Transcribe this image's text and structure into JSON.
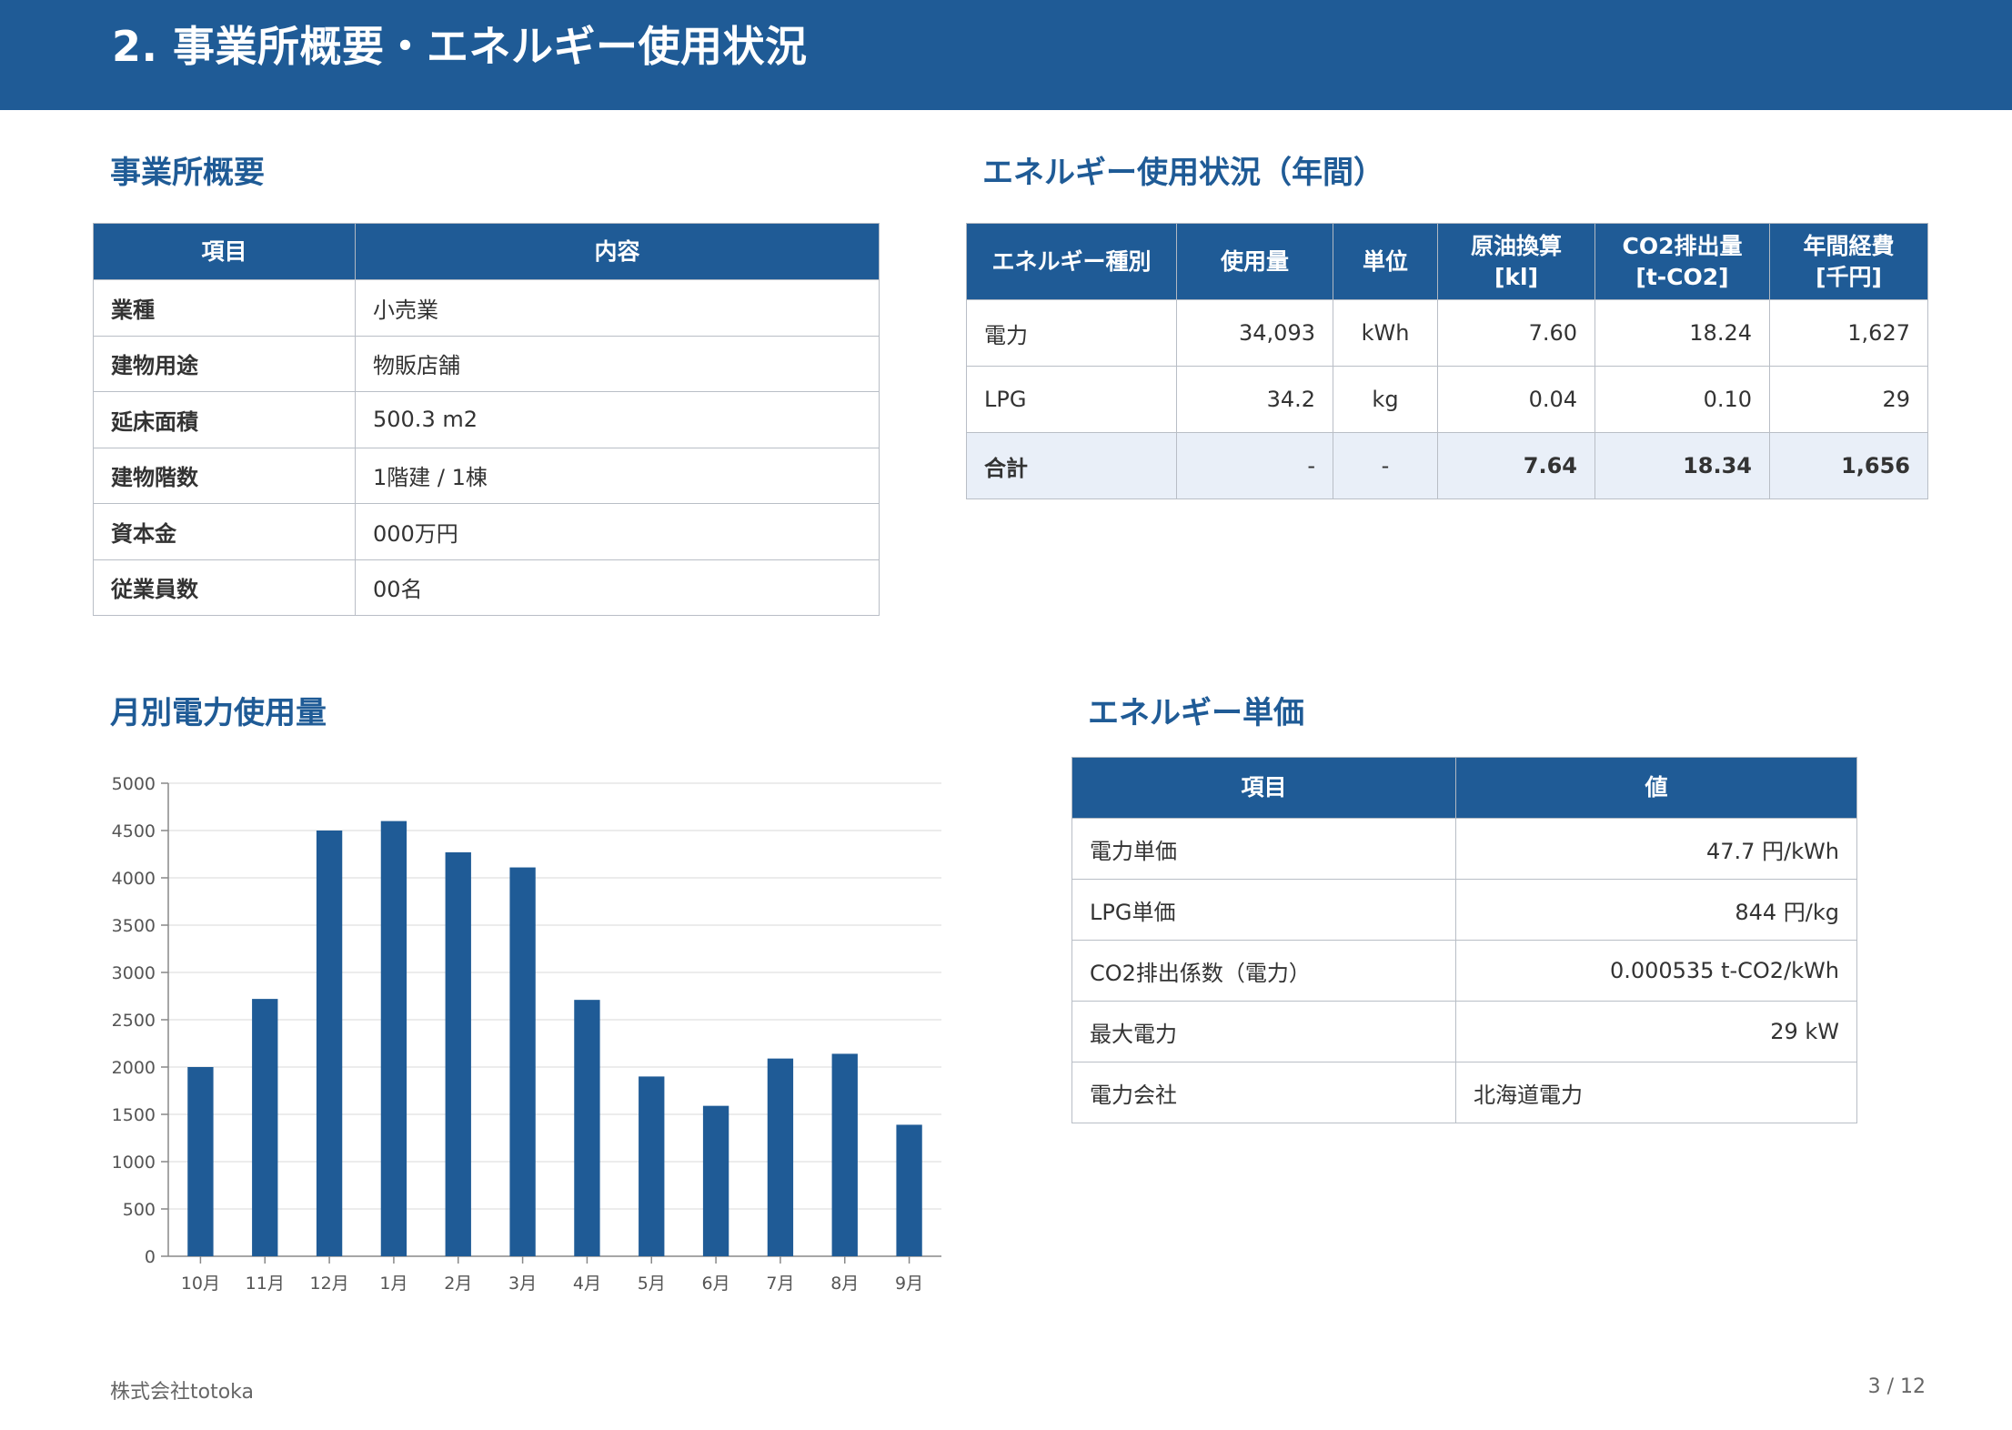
{
  "header": {
    "title": "2. 事業所概要・エネルギー使用状況"
  },
  "office": {
    "title": "事業所概要",
    "headers": [
      "項目",
      "内容"
    ],
    "rows": [
      [
        "業種",
        "小売業"
      ],
      [
        "建物用途",
        "物販店舗"
      ],
      [
        "延床面積",
        "500.3 m2"
      ],
      [
        "建物階数",
        "1階建 / 1棟"
      ],
      [
        "資本金",
        "000万円"
      ],
      [
        "従業員数",
        "00名"
      ]
    ]
  },
  "energy": {
    "title": "エネルギー使用状況（年間）",
    "headers": [
      [
        "エネルギー種別"
      ],
      [
        "使用量"
      ],
      [
        "単位"
      ],
      [
        "原油換算",
        "[kl]"
      ],
      [
        "CO2排出量",
        "[t-CO2]"
      ],
      [
        "年間経費",
        "[千円]"
      ]
    ],
    "rows": [
      [
        "電力",
        "34,093",
        "kWh",
        "7.60",
        "18.24",
        "1,627"
      ],
      [
        "LPG",
        "34.2",
        "kg",
        "0.04",
        "0.10",
        "29"
      ]
    ],
    "total": [
      "合計",
      "-",
      "-",
      "7.64",
      "18.34",
      "1,656"
    ]
  },
  "monthly": {
    "title": "月別電力使用量"
  },
  "price": {
    "title": "エネルギー単価",
    "headers": [
      "項目",
      "値"
    ],
    "rows": [
      [
        "電力単価",
        "47.7 円/kWh"
      ],
      [
        "LPG単価",
        "844 円/kg"
      ],
      [
        "CO2排出係数（電力）",
        "0.000535 t-CO2/kWh"
      ],
      [
        "最大電力",
        "29 kW"
      ],
      [
        "電力会社",
        "北海道電力"
      ]
    ]
  },
  "footer": {
    "company": "株式会社totoka",
    "page": "3 / 12"
  },
  "colors": {
    "primary": "#1f5b96",
    "total_row": "#e9eff8",
    "grid": "#e6e6e6"
  },
  "chart_data": {
    "type": "bar",
    "categories": [
      "10月",
      "11月",
      "12月",
      "1月",
      "2月",
      "3月",
      "4月",
      "5月",
      "6月",
      "7月",
      "8月",
      "9月"
    ],
    "values": [
      2000,
      2720,
      4500,
      4600,
      4270,
      4110,
      2710,
      1900,
      1590,
      2090,
      2140,
      1390
    ],
    "yticks": [
      "0",
      "500",
      "1000",
      "1500",
      "2000",
      "2500",
      "3000",
      "3500",
      "4000",
      "4500",
      "5000"
    ],
    "ylim": [
      0,
      5000
    ],
    "title": "",
    "xlabel": "",
    "ylabel": "",
    "grid": true,
    "legend": "none"
  }
}
